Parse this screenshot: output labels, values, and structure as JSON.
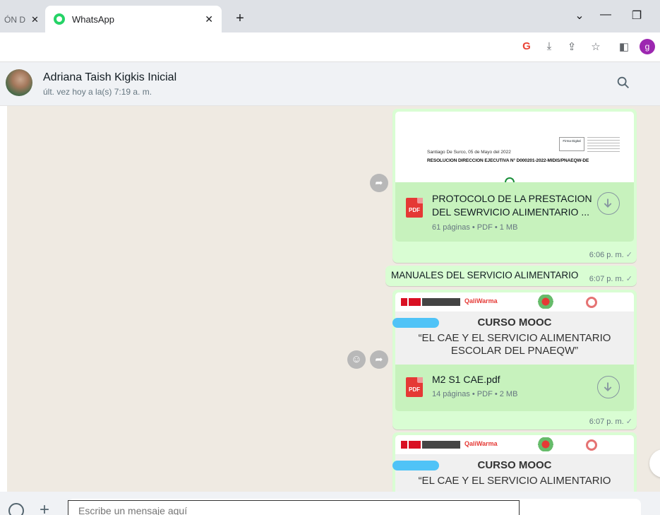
{
  "browser": {
    "prev_tab_label": "ÓN D",
    "prev_tab_close": "✕",
    "active_tab_title": "WhatsApp",
    "active_tab_close": "✕",
    "new_tab": "+",
    "dropdown": "⌄",
    "minimize": "—",
    "restore": "❐",
    "profile_initial": "g"
  },
  "toolbar_icons": [
    "google-icon",
    "install-icon",
    "share-icon",
    "bookmark-star-icon",
    "side-panel-icon"
  ],
  "chat_header": {
    "contact_name": "Adriana Taish Kigkis Inicial",
    "last_seen": "últ. vez hoy a la(s) 7:19 a. m."
  },
  "messages": [
    {
      "type": "document",
      "preview_line1": "Santiago De Surco, 05 de Mayo del 2022",
      "preview_line2": "RESOLUCION DIRECCION EJECUTIVA N°  D000201-2022-MIDIS/PNAEQW-DE",
      "stamp_text": "Firma Digital",
      "file_badge": "PDF",
      "file_title": "PROTOCOLO DE LA PRESTACION DEL SEWRVICIO ALIMENTARIO ...",
      "file_meta": "61 páginas • PDF • 1 MB",
      "time": "6:06 p. m.",
      "status": "✓"
    },
    {
      "type": "text",
      "text": "MANUALES DEL SERVICIO ALIMENTARIO",
      "time": "6:07 p. m.",
      "status": "✓"
    },
    {
      "type": "document",
      "banner_brand": "QaliWarma",
      "course_title": "CURSO MOOC",
      "course_sub_1": "“EL CAE Y EL SERVICIO ALIMENTARIO",
      "course_sub_2": "ESCOLAR DEL PNAEQW”",
      "file_badge": "PDF",
      "file_title": "M2 S1 CAE.pdf",
      "file_meta": "14 páginas • PDF • 2 MB",
      "time": "6:07 p. m.",
      "status": "✓"
    },
    {
      "type": "document",
      "banner_brand": "QaliWarma",
      "course_title": "CURSO MOOC",
      "course_sub_1": "“EL CAE Y EL SERVICIO ALIMENTARIO"
    }
  ],
  "composer": {
    "placeholder": "Escribe un mensaje aquí"
  }
}
